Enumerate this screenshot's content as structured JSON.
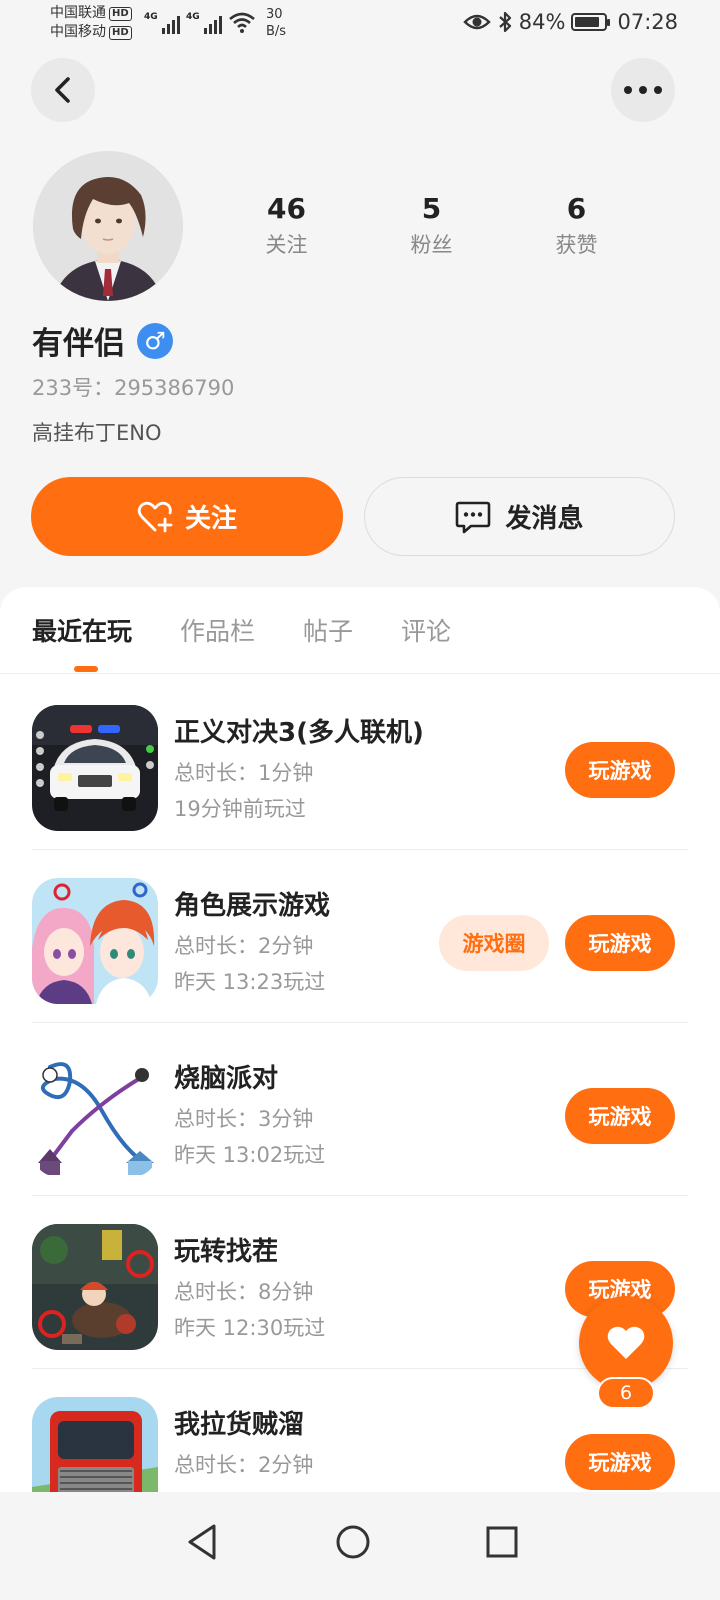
{
  "status_bar": {
    "carrier1": "中国联通",
    "carrier2": "中国移动",
    "hd": "HD",
    "net1": "4G",
    "net2": "4G",
    "speed_value": "30",
    "speed_unit": "B/s",
    "battery": "84%",
    "battery_level": 0.84,
    "time": "07:28"
  },
  "profile": {
    "name": "有伴侣",
    "gender_symbol": "♂",
    "uid": "233号：295386790",
    "bio": "高挂布丁ENO",
    "stats": [
      {
        "value": "46",
        "label": "关注"
      },
      {
        "value": "5",
        "label": "粉丝"
      },
      {
        "value": "6",
        "label": "获赞"
      }
    ]
  },
  "actions": {
    "follow": "关注",
    "message": "发消息"
  },
  "tabs": [
    "最近在玩",
    "作品栏",
    "帖子",
    "评论"
  ],
  "games": [
    {
      "title": "正义对决3(多人联机)",
      "duration": "总时长：1分钟",
      "last_played": "19分钟前玩过",
      "play": "玩游戏",
      "circle": ""
    },
    {
      "title": "角色展示游戏",
      "duration": "总时长：2分钟",
      "last_played": "昨天 13:23玩过",
      "play": "玩游戏",
      "circle": "游戏圈"
    },
    {
      "title": "烧脑派对",
      "duration": "总时长：3分钟",
      "last_played": "昨天 13:02玩过",
      "play": "玩游戏",
      "circle": ""
    },
    {
      "title": "玩转找茬",
      "duration": "总时长：8分钟",
      "last_played": "昨天 12:30玩过",
      "play": "玩游戏",
      "circle": ""
    },
    {
      "title": "我拉货贼溜",
      "duration": "总时长：2分钟",
      "last_played": "",
      "play": "玩游戏",
      "circle": ""
    }
  ],
  "like_fab": {
    "count": "6"
  },
  "colors": {
    "accent": "#ff6e10",
    "gender": "#3d8ef0"
  }
}
